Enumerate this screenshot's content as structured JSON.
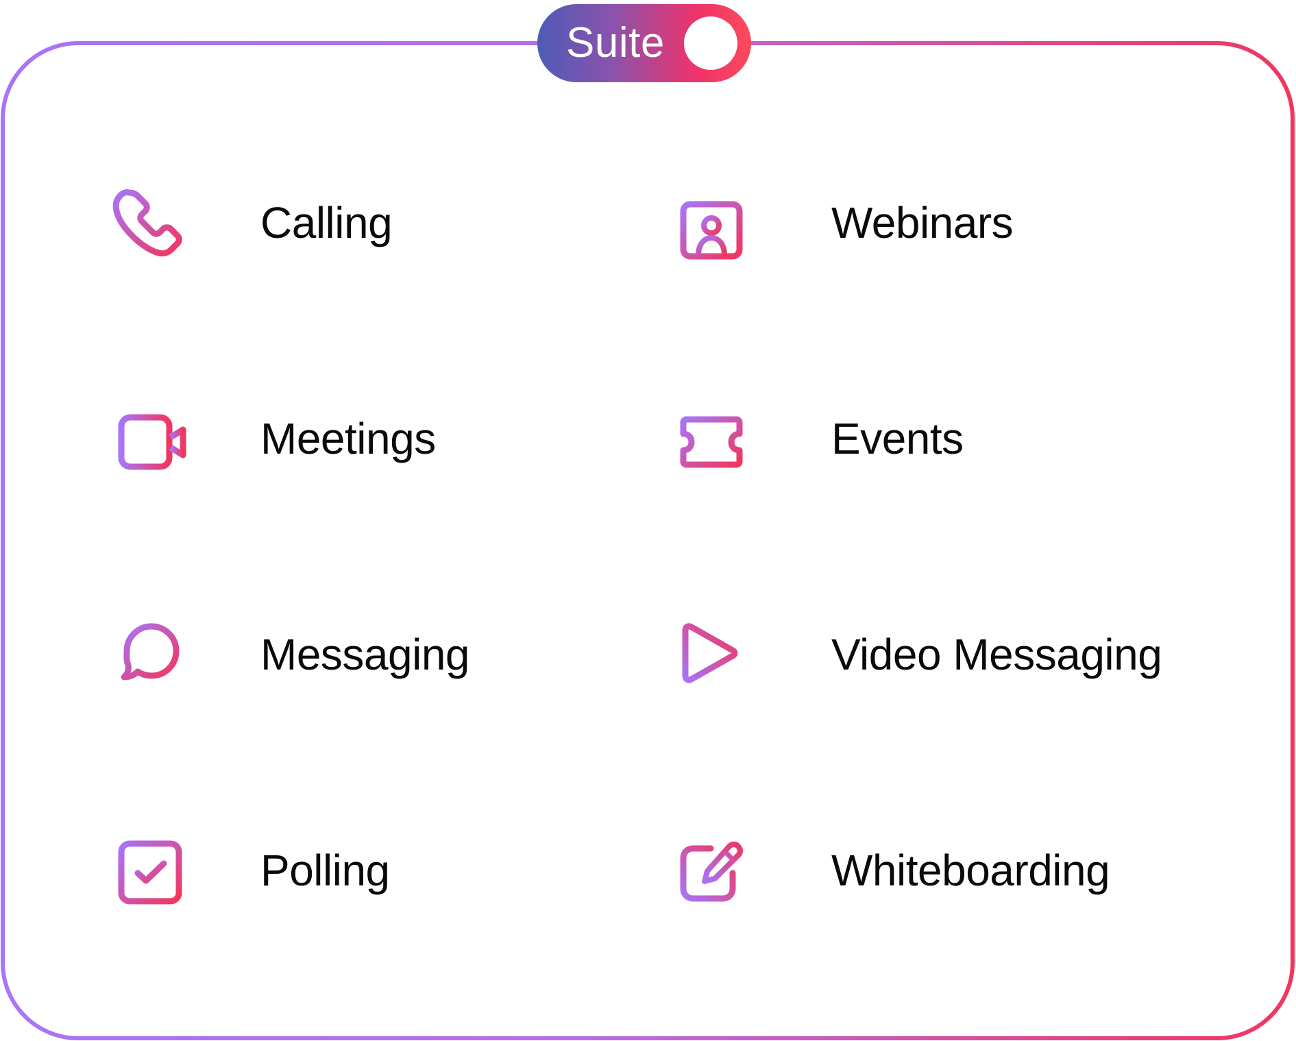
{
  "suite_toggle": {
    "label": "Suite",
    "state": "on"
  },
  "colors": {
    "gradient_start": "#a874f8",
    "gradient_end": "#f2355e",
    "toggle_start": "#4f5bb7",
    "toggle_end": "#fb4a5b",
    "text": "#0a0a0a",
    "background": "#ffffff"
  },
  "features": [
    {
      "label": "Calling",
      "icon": "phone-icon"
    },
    {
      "label": "Webinars",
      "icon": "presenter-icon"
    },
    {
      "label": "Meetings",
      "icon": "video-camera-icon"
    },
    {
      "label": "Events",
      "icon": "ticket-icon"
    },
    {
      "label": "Messaging",
      "icon": "chat-bubble-icon"
    },
    {
      "label": "Video Messaging",
      "icon": "play-icon"
    },
    {
      "label": "Polling",
      "icon": "checkbox-icon"
    },
    {
      "label": "Whiteboarding",
      "icon": "pencil-edit-icon"
    }
  ]
}
